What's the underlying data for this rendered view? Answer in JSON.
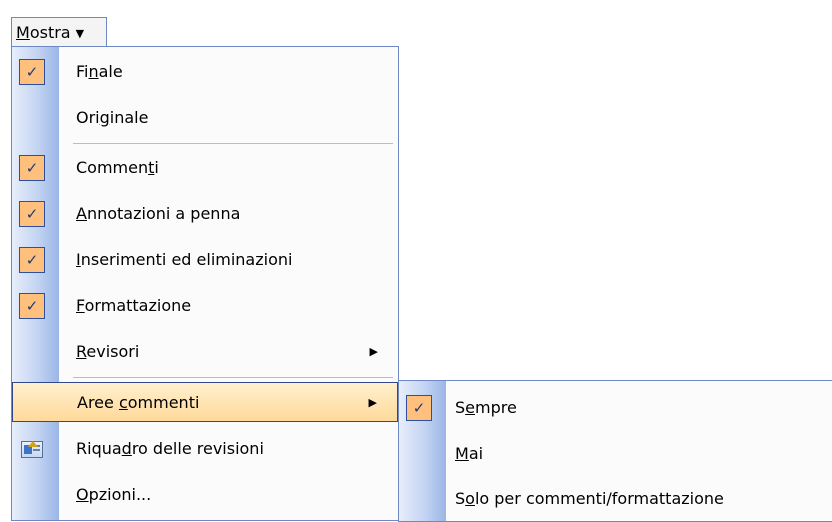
{
  "menu_button": {
    "label_u": "M",
    "label_rest": "ostra",
    "caret": "▼"
  },
  "menu": {
    "items": [
      {
        "pre": "Fi",
        "u": "n",
        "post": "ale",
        "checked": true
      },
      {
        "pre": "Ori",
        "u": "g",
        "post": "inale",
        "checked": false
      },
      {
        "pre": "Commen",
        "u": "t",
        "post": "i",
        "checked": true
      },
      {
        "pre": "",
        "u": "A",
        "post": "nnotazioni a penna",
        "checked": true
      },
      {
        "pre": "",
        "u": "I",
        "post": "nserimenti ed eliminazioni",
        "checked": true
      },
      {
        "pre": "",
        "u": "F",
        "post": "ormattazione",
        "checked": true
      },
      {
        "pre": "",
        "u": "R",
        "post": "evisori",
        "checked": false,
        "submenu_arrow": "▶"
      },
      {
        "pre": "Aree ",
        "u": "c",
        "post": "ommenti",
        "checked": false,
        "submenu_arrow": "▶",
        "highlighted": true
      },
      {
        "pre": "Riqua",
        "u": "d",
        "post": "ro delle revisioni",
        "icon": "review-pane-icon"
      },
      {
        "pre": "",
        "u": "O",
        "post": "pzioni...",
        "checked": false
      }
    ]
  },
  "submenu": {
    "items": [
      {
        "pre": "S",
        "u": "e",
        "post": "mpre",
        "checked": true
      },
      {
        "pre": "",
        "u": "M",
        "post": "ai",
        "checked": false
      },
      {
        "pre": "S",
        "u": "o",
        "post": "lo per commenti/formattazione",
        "checked": false
      }
    ]
  },
  "check_glyph": "✓",
  "colors": {
    "accent_border": "#6d88c4",
    "highlight": "#ffd99a",
    "check_bg": "#ffc07e"
  }
}
